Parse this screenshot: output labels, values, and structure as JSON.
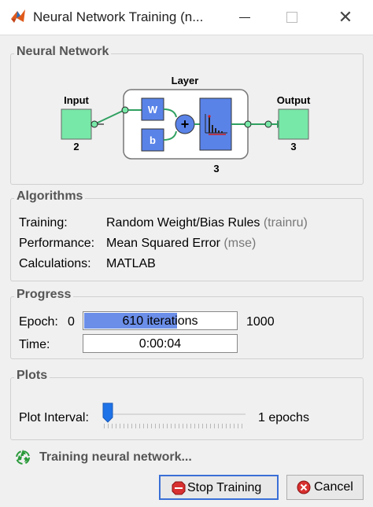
{
  "window": {
    "title": "Neural Network Training (n...",
    "app_icon": "matlab-icon"
  },
  "neural_network": {
    "section_title": "Neural Network",
    "input_label": "Input",
    "input_size": "2",
    "layer_label": "Layer",
    "layer_size": "3",
    "weight_label": "W",
    "bias_label": "b",
    "output_label": "Output",
    "output_size": "3",
    "colors": {
      "block_green": "#78e8a8",
      "block_blue": "#5a83e8"
    }
  },
  "algorithms": {
    "section_title": "Algorithms",
    "rows": [
      {
        "label": "Training:",
        "value": "Random Weight/Bias Rules",
        "abbr": "(trainru)"
      },
      {
        "label": "Performance:",
        "value": "Mean Squared Error",
        "abbr": "(mse)"
      },
      {
        "label": "Calculations:",
        "value": "MATLAB",
        "abbr": ""
      }
    ]
  },
  "progress": {
    "section_title": "Progress",
    "epoch_label": "Epoch:",
    "epoch_min": "0",
    "epoch_text": "610 iterations",
    "epoch_max": "1000",
    "epoch_fraction": 0.61,
    "time_label": "Time:",
    "time_text": "0:00:04",
    "bar_color": "#6b8ee8"
  },
  "plots": {
    "section_title": "Plots",
    "interval_label": "Plot Interval:",
    "interval_value": "1 epochs",
    "slider_level": 0
  },
  "status": {
    "text": "Training neural network...",
    "icon": "recycle-icon"
  },
  "buttons": {
    "stop_label": "Stop Training",
    "cancel_label": "Cancel"
  }
}
